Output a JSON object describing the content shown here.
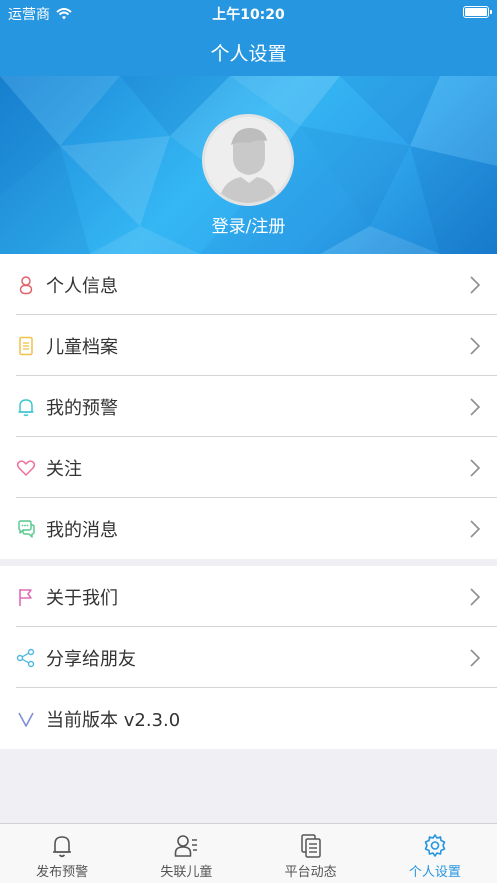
{
  "status_bar": {
    "carrier": "运营商",
    "time": "上午10:20"
  },
  "nav": {
    "title": "个人设置"
  },
  "profile": {
    "login_label": "登录/注册"
  },
  "menu_group_1": [
    {
      "label": "个人信息",
      "icon": "user-icon",
      "color": "#e0636a"
    },
    {
      "label": "儿童档案",
      "icon": "document-icon",
      "color": "#f0c24a"
    },
    {
      "label": "我的预警",
      "icon": "bell-icon",
      "color": "#3ec6d0"
    },
    {
      "label": "关注",
      "icon": "heart-icon",
      "color": "#ef6e9b"
    },
    {
      "label": "我的消息",
      "icon": "chat-icon",
      "color": "#53c98d"
    }
  ],
  "menu_group_2": [
    {
      "label": "关于我们",
      "icon": "flag-icon",
      "color": "#e06bb5"
    },
    {
      "label": "分享给朋友",
      "icon": "share-icon",
      "color": "#52b8e0"
    },
    {
      "label": "当前版本 v2.3.0",
      "icon": "version-icon",
      "color": "#7f8fd4"
    }
  ],
  "tabs": [
    {
      "label": "发布预警",
      "icon": "bell-icon",
      "active": false
    },
    {
      "label": "失联儿童",
      "icon": "person-list-icon",
      "active": false
    },
    {
      "label": "平台动态",
      "icon": "document-icon",
      "active": false
    },
    {
      "label": "个人设置",
      "icon": "gear-icon",
      "active": true
    }
  ],
  "colors": {
    "accent": "#2796e1",
    "background": "#efeff4"
  }
}
